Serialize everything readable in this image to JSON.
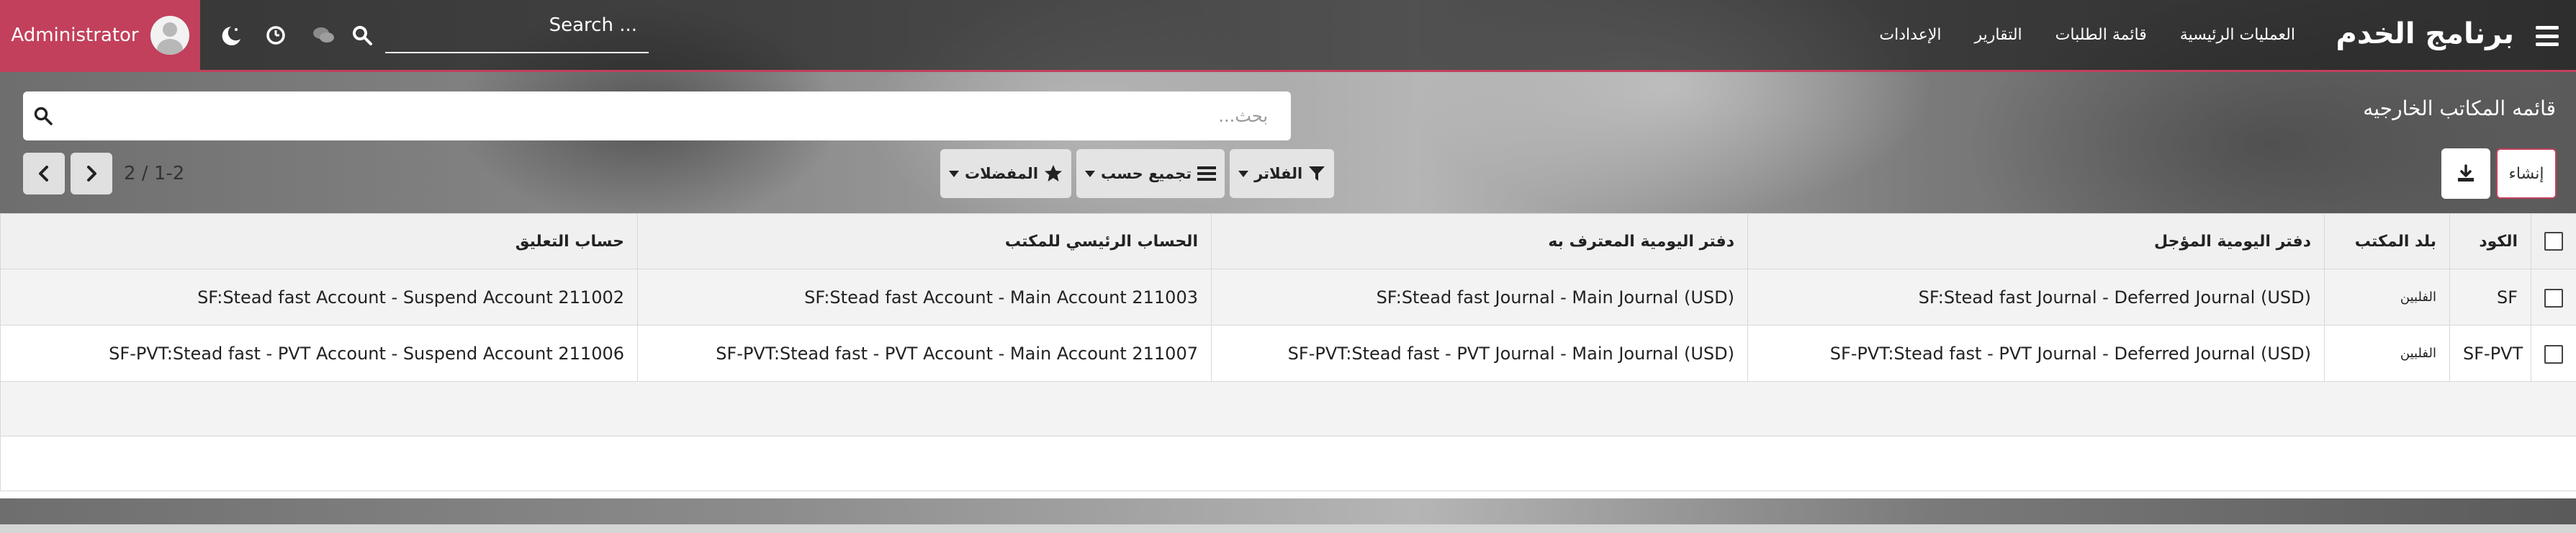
{
  "navbar": {
    "brand": "برنامج الخدم",
    "menu": [
      "العمليات الرئيسية",
      "قائمة الطلبات",
      "التقارير",
      "الإعدادات"
    ],
    "search_placeholder": "Search ...",
    "user_name": "Administrator",
    "accent_color": "#c2405c"
  },
  "control_panel": {
    "title": "قائمه المكاتب الخارجيه",
    "search_placeholder": "بحث...",
    "create_label": "إنشاء",
    "filters_label": "الفلاتر",
    "group_by_label": "تجميع حسب",
    "favorites_label": "المفضلات",
    "pager_value": "2 / 1-2"
  },
  "table": {
    "headers": {
      "code": "الكود",
      "country": "بلد المكتب",
      "deferred_journal": "دفتر اليومية المؤجل",
      "recognized_journal": "دفتر اليومية المعترف به",
      "main_account": "الحساب الرئيسي للمكتب",
      "suspend_account": "حساب التعليق"
    },
    "rows": [
      {
        "code": "SF",
        "country": "الفلبين",
        "deferred_journal": "SF:Stead fast Journal - Deferred Journal (USD)",
        "recognized_journal": "SF:Stead fast Journal - Main Journal (USD)",
        "main_account": "SF:Stead fast Account - Main Account 211003",
        "suspend_account": "SF:Stead fast Account - Suspend Account 211002"
      },
      {
        "code": "SF-PVT",
        "country": "الفلبين",
        "deferred_journal": "SF-PVT:Stead fast - PVT Journal - Deferred Journal (USD)",
        "recognized_journal": "SF-PVT:Stead fast - PVT Journal - Main Journal (USD)",
        "main_account": "SF-PVT:Stead fast - PVT Account - Main Account 211007",
        "suspend_account": "SF-PVT:Stead fast - PVT Account - Suspend Account 211006"
      }
    ]
  }
}
